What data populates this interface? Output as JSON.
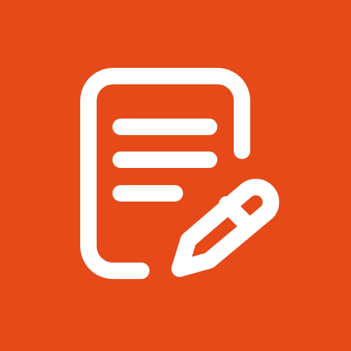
{
  "icon": {
    "name": "note-edit-icon",
    "background_color": "#E64A19",
    "foreground_color": "#FFFFFF",
    "elements": [
      "document-outline",
      "text-line",
      "text-line",
      "text-line",
      "pencil"
    ]
  }
}
